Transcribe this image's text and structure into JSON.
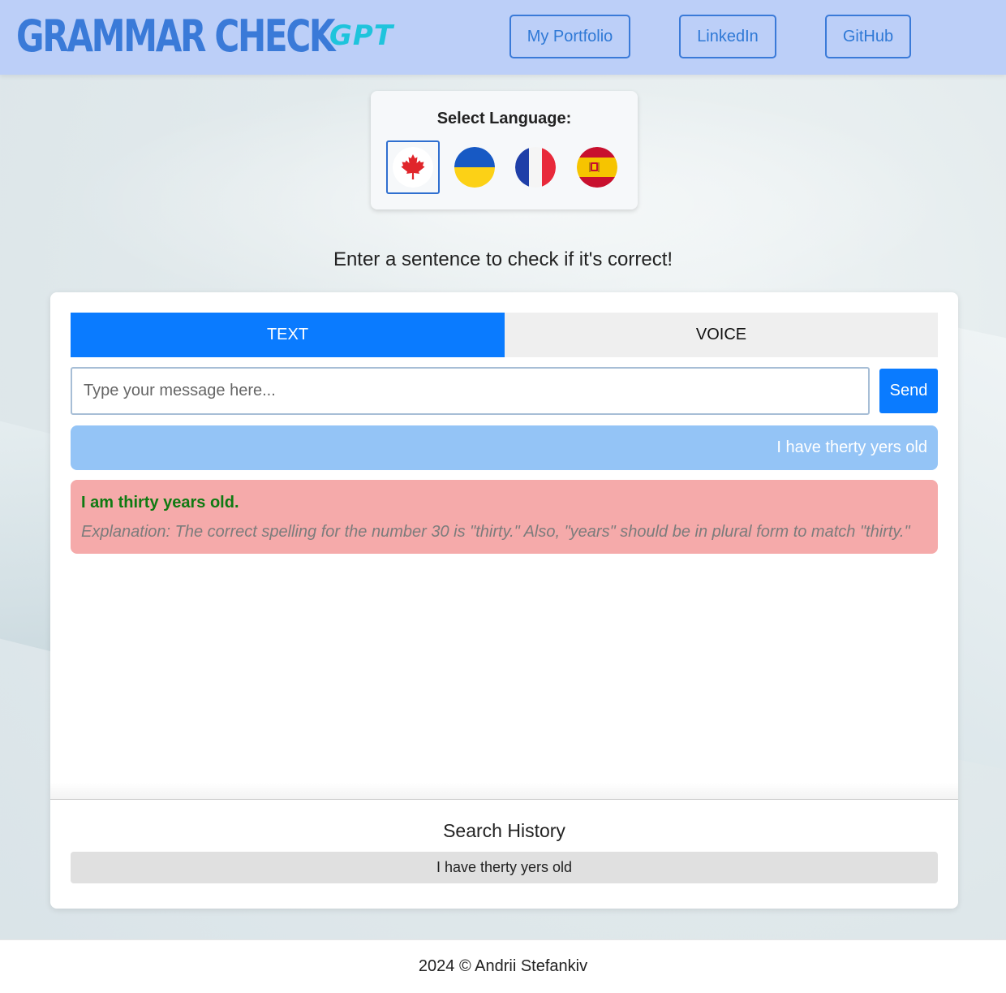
{
  "header": {
    "logo_main": "GRAMMAR CHECK",
    "logo_suffix": "GPT",
    "nav": [
      {
        "label": "My Portfolio"
      },
      {
        "label": "LinkedIn"
      },
      {
        "label": "GitHub"
      }
    ]
  },
  "language": {
    "title": "Select Language:",
    "flags": [
      {
        "icon": "canada-flag-icon",
        "selected": true
      },
      {
        "icon": "ukraine-flag-icon",
        "selected": false
      },
      {
        "icon": "france-flag-icon",
        "selected": false
      },
      {
        "icon": "spain-flag-icon",
        "selected": false
      }
    ]
  },
  "prompt": "Enter a sentence to check if it's correct!",
  "tabs": [
    {
      "label": "TEXT",
      "active": true
    },
    {
      "label": "VOICE",
      "active": false
    }
  ],
  "input": {
    "placeholder": "Type your message here...",
    "value": "",
    "send_label": "Send"
  },
  "conversation": {
    "user_message": "I have therty yers old",
    "corrected": "I am thirty years old.",
    "explanation": "Explanation: The correct spelling for the number 30 is \"thirty.\" Also, \"years\" should be in plural form to match \"thirty.\""
  },
  "history": {
    "title": "Search History",
    "items": [
      "I have therty yers old"
    ]
  },
  "footer": "2024 © Andrii Stefankiv",
  "colors": {
    "header_bg": "#bccff8",
    "accent": "#0a7bff",
    "user_bubble": "#94c4f6",
    "reply_bubble": "#f5aaaa",
    "correct_text": "#0f7a12"
  }
}
